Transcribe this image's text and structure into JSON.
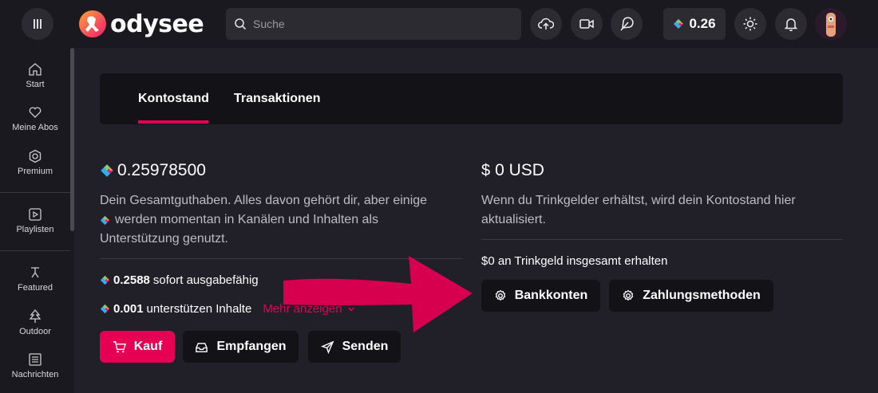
{
  "header": {
    "logo_text": "odysee",
    "search_placeholder": "Suche",
    "balance": "0.26"
  },
  "sidebar": {
    "items": [
      {
        "label": "Start",
        "icon": "home-icon"
      },
      {
        "label": "Meine Abos",
        "icon": "heart-icon"
      },
      {
        "label": "Premium",
        "icon": "premium-icon"
      },
      {
        "label": "Playlisten",
        "icon": "playlist-icon"
      },
      {
        "label": "Featured",
        "icon": "featured-icon"
      },
      {
        "label": "Outdoor",
        "icon": "tree-icon"
      },
      {
        "label": "Nachrichten",
        "icon": "news-icon"
      }
    ]
  },
  "tabs": [
    {
      "label": "Kontostand",
      "active": true
    },
    {
      "label": "Transaktionen",
      "active": false
    }
  ],
  "credits": {
    "total": "0.25978500",
    "desc_part1": "Dein Gesamtguthaben. Alles davon gehört dir, aber einige",
    "desc_part2": "werden momentan in Kanälen und Inhalten als",
    "desc_part3": "Unterstützung genutzt.",
    "available_amount": "0.2588",
    "available_label": "sofort ausgabefähig",
    "supporting_amount": "0.001",
    "supporting_label": "unterstützen Inhalte",
    "show_more": "Mehr anzeigen"
  },
  "usd": {
    "symbol": "$",
    "total": "0 USD",
    "desc_line1": "Wenn du Trinkgelder erhältst, wird dein Kontostand hier",
    "desc_line2": "aktualisiert.",
    "tips_total": "$0 an Trinkgeld insgesamt erhalten"
  },
  "buttons": {
    "buy": "Kauf",
    "receive": "Empfangen",
    "send": "Senden",
    "bank_accounts": "Bankkonten",
    "payment_methods": "Zahlungsmethoden"
  },
  "colors": {
    "accent": "#e50054",
    "background": "#211f27",
    "surface": "#131217"
  }
}
